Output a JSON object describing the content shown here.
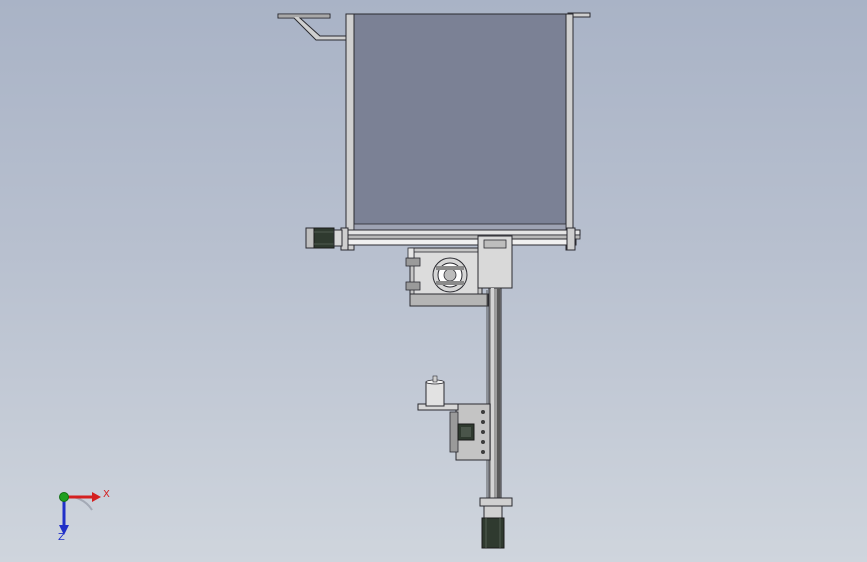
{
  "viewport": {
    "background_top": "#a9b3c6",
    "background_bottom": "#cfd5dd"
  },
  "model": {
    "frame_fill": "#7b8195",
    "frame_stroke": "#2a2a30",
    "metal_light": "#cfcfcf",
    "metal_mid": "#9a9a9a",
    "metal_dark": "#3c3c3c",
    "motor_body": "#2f3a2f"
  },
  "triad": {
    "x_label": "X",
    "y_label": "Y",
    "z_label": "Z",
    "x_color": "#d42020",
    "y_color": "#1fa01f",
    "z_color": "#2030c8"
  }
}
